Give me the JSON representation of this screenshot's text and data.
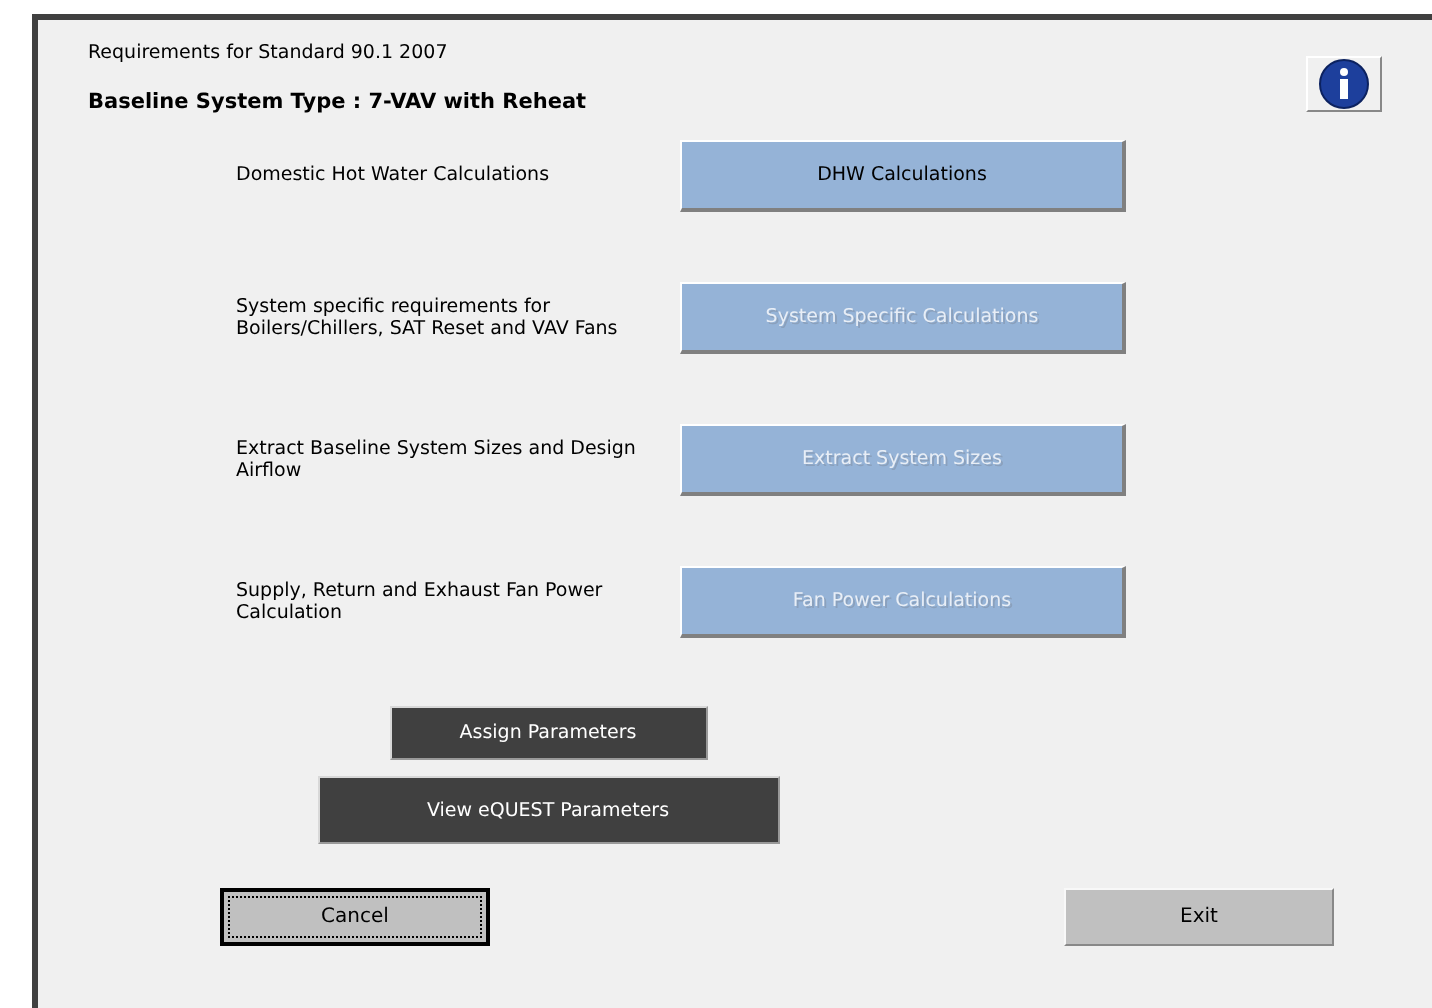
{
  "header": {
    "subtitle": "Requirements for Standard 90.1 2007",
    "title": "Baseline System Type : 7-VAV with Reheat"
  },
  "rows": [
    {
      "description": "Domestic Hot Water Calculations",
      "button": "DHW Calculations",
      "disabled": false
    },
    {
      "description": "System specific requirements for Boilers/Chillers, SAT Reset and VAV Fans",
      "button": "System Specific Calculations",
      "disabled": true
    },
    {
      "description": "Extract Baseline System Sizes and Design Airflow",
      "button": "Extract System Sizes",
      "disabled": true
    },
    {
      "description": "Supply, Return and Exhaust Fan Power Calculation",
      "button": "Fan Power Calculations",
      "disabled": true
    }
  ],
  "center_buttons": [
    "Assign Parameters",
    "View eQUEST Parameters"
  ],
  "bottom_buttons": [
    {
      "label": "Cancel",
      "focused": true
    },
    {
      "label": "Exit",
      "focused": false
    }
  ]
}
